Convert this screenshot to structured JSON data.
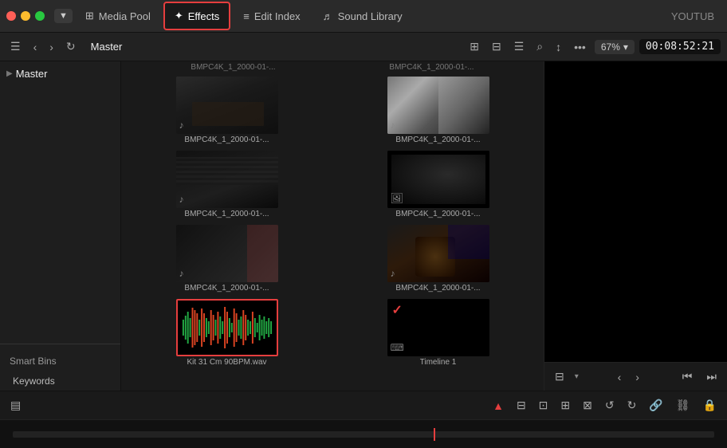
{
  "window": {
    "title": "YOUTUB",
    "controls": {
      "close": "close",
      "minimize": "minimize",
      "maximize": "maximize"
    }
  },
  "topbar": {
    "dropdown_icon": "▼",
    "media_pool_label": "Media Pool",
    "effects_label": "Effects",
    "edit_index_label": "Edit Index",
    "sound_library_label": "Sound Library",
    "zoom": "67%",
    "timecode": "00:08:52:21"
  },
  "sidebar": {
    "master_label": "Master",
    "smart_bins_label": "Smart Bins",
    "keywords_label": "Keywords"
  },
  "media_grid": {
    "items": [
      {
        "id": 1,
        "label": "BMPC4K_1_2000-01-...",
        "type": "video",
        "icon": "♪",
        "thumb_class": "thumb-1",
        "selected": false
      },
      {
        "id": 2,
        "label": "BMPC4K_1_2000-01-...",
        "type": "video",
        "icon": "♪",
        "thumb_class": "thumb-2",
        "selected": false
      },
      {
        "id": 3,
        "label": "BMPC4K_1_2000-01-...",
        "type": "video",
        "icon": "♪",
        "thumb_class": "thumb-3",
        "selected": false
      },
      {
        "id": 4,
        "label": "BMPC4K_1_2000-01-...",
        "type": "video_image",
        "icon": "🖼",
        "thumb_class": "thumb-4",
        "selected": false
      },
      {
        "id": 5,
        "label": "BMPC4K_1_2000-01-...",
        "type": "video",
        "icon": "♪",
        "thumb_class": "thumb-5",
        "selected": false
      },
      {
        "id": 6,
        "label": "BMPC4K_1_2000-01-...",
        "type": "video",
        "icon": "♪",
        "thumb_class": "thumb-6",
        "selected": false
      },
      {
        "id": 7,
        "label": "Kit 31 Cm 90BPM.wav",
        "type": "audio",
        "icon": "",
        "thumb_class": "thumb-audio",
        "selected": true
      },
      {
        "id": 8,
        "label": "Timeline 1",
        "type": "timeline",
        "icon": "⌨",
        "thumb_class": "thumb-timeline",
        "selected": false
      }
    ]
  },
  "bottom_toolbar": {
    "icons": [
      "▤",
      "◀",
      "▶",
      "⊟",
      "⊡",
      "⊞",
      "⊠",
      "↺",
      "↻",
      "🔒"
    ],
    "cursor_icon": "▲",
    "film_strip_icon": "▤",
    "link_icon": "🔗",
    "lock_icon": "🔒"
  },
  "preview": {
    "nav_icons": [
      "◀◀",
      "◀",
      "▶",
      "▶▶"
    ]
  }
}
